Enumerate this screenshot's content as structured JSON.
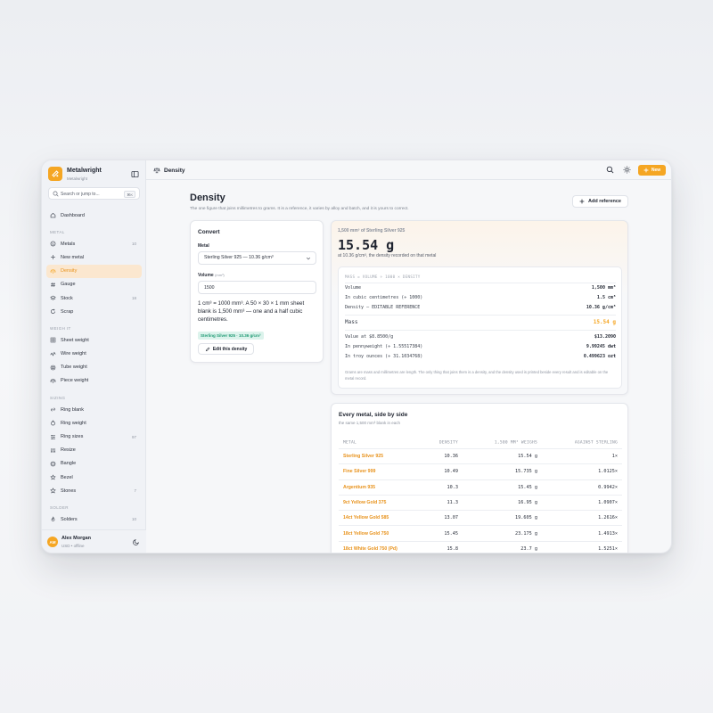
{
  "brand": {
    "name": "Metalwright",
    "subtitle": "Metalwright"
  },
  "search": {
    "placeholder": "Search or jump to...",
    "shortcut": "⌘K"
  },
  "sidebar": {
    "dashboard": "Dashboard",
    "sections": [
      {
        "label": "METAL",
        "items": [
          {
            "label": "Metals",
            "count": "10",
            "icon": "coin-icon"
          },
          {
            "label": "New metal",
            "count": "",
            "icon": "plus-icon"
          },
          {
            "label": "Density",
            "count": "",
            "icon": "scale-icon",
            "active": true
          },
          {
            "label": "Gauge",
            "count": "",
            "icon": "hash-icon"
          },
          {
            "label": "Stock",
            "count": "18",
            "icon": "layers-icon"
          },
          {
            "label": "Scrap",
            "count": "",
            "icon": "recycle-icon"
          }
        ]
      },
      {
        "label": "WEIGH IT",
        "items": [
          {
            "label": "Sheet weight",
            "count": "",
            "icon": "grid-icon"
          },
          {
            "label": "Wire weight",
            "count": "",
            "icon": "wave-icon"
          },
          {
            "label": "Tube weight",
            "count": "",
            "icon": "tube-icon"
          },
          {
            "label": "Piece weight",
            "count": "",
            "icon": "scale-icon"
          }
        ]
      },
      {
        "label": "SIZING",
        "items": [
          {
            "label": "Ring blank",
            "count": "",
            "icon": "link-icon"
          },
          {
            "label": "Ring weight",
            "count": "",
            "icon": "ring-icon"
          },
          {
            "label": "Ring sizes",
            "count": "97",
            "icon": "ruler-icon"
          },
          {
            "label": "Resize",
            "count": "",
            "icon": "sliders-icon"
          },
          {
            "label": "Bangle",
            "count": "",
            "icon": "bangle-icon"
          },
          {
            "label": "Bezel",
            "count": "",
            "icon": "gem-icon"
          },
          {
            "label": "Stones",
            "count": "7",
            "icon": "star-icon"
          }
        ]
      },
      {
        "label": "SOLDER",
        "items": [
          {
            "label": "Solders",
            "count": "10",
            "icon": "flame-icon"
          }
        ]
      }
    ]
  },
  "user": {
    "initials": "AM",
    "name": "Alex Morgan",
    "meta": "USD • offline"
  },
  "topbar": {
    "title": "Density",
    "new_label": "New"
  },
  "page": {
    "title": "Density",
    "description": "The one figure that joins millimetres to grams. It is a reference, it varies by alloy and batch, and it is yours to correct.",
    "add_reference": "Add reference"
  },
  "convert": {
    "title": "Convert",
    "metal_label": "Metal",
    "metal_value": "Sterling Silver 925 — 10.36 g/cm³",
    "volume_label": "Volume",
    "volume_unit": "(mm³)",
    "volume_value": "1500",
    "explanation": "1 cm³ = 1000 mm³. A 50 × 30 × 1 mm sheet blank is 1,500 mm³ — one and a half cubic centimetres.",
    "tag": "Sterling Silver 925 · 10.36 g/cm³",
    "edit_label": "Edit this density"
  },
  "result": {
    "heading": "1,500 mm³ of Sterling Silver 925",
    "value": "15.54 g",
    "note": "at 10.36 g/cm³, the density recorded on that metal",
    "formula": "MASS = VOLUME ÷ 1000 × DENSITY",
    "rows1": [
      {
        "label": "Volume",
        "value": "1,500 mm³"
      },
      {
        "label": "In cubic centimetres (÷ 1000)",
        "value": "1.5 cm³"
      },
      {
        "label": "Density — EDITABLE REFERENCE",
        "value": "10.36 g/cm³"
      }
    ],
    "mass": {
      "label": "Mass",
      "value": "15.54 g"
    },
    "rows2": [
      {
        "label": "Value at $8.8500/g",
        "value": "$13.2090"
      },
      {
        "label": "In pennyweight (÷ 1.55517384)",
        "value": "9.99245 dwt"
      },
      {
        "label": "In troy ounces (÷ 31.1034768)",
        "value": "0.499623 ozt"
      }
    ],
    "footnote": "Grams are mass and millimetres are length. The only thing that joins them is a density, and the density used is printed beside every result and is editable on the metal record."
  },
  "compare": {
    "title": "Every metal, side by side",
    "subtitle": "the same 1,500 mm³ blank in each",
    "headers": [
      "METAL",
      "DENSITY",
      "1,500 MM³ WEIGHS",
      "AGAINST STERLING"
    ],
    "rows": [
      [
        "Sterling Silver 925",
        "10.36",
        "15.54 g",
        "1×"
      ],
      [
        "Fine Silver 999",
        "10.49",
        "15.735 g",
        "1.0125×"
      ],
      [
        "Argentium 935",
        "10.3",
        "15.45 g",
        "0.9942×"
      ],
      [
        "9ct Yellow Gold 375",
        "11.3",
        "16.95 g",
        "1.0907×"
      ],
      [
        "14ct Yellow Gold 585",
        "13.07",
        "19.605 g",
        "1.2616×"
      ],
      [
        "18ct Yellow Gold 750",
        "15.45",
        "23.175 g",
        "1.4913×"
      ],
      [
        "18ct White Gold 750 (Pd)",
        "15.8",
        "23.7 g",
        "1.5251×"
      ]
    ]
  },
  "colors": {
    "accent": "#f5a623",
    "active_bg": "#fbe7cf",
    "tag_green": "#1e9a73"
  }
}
